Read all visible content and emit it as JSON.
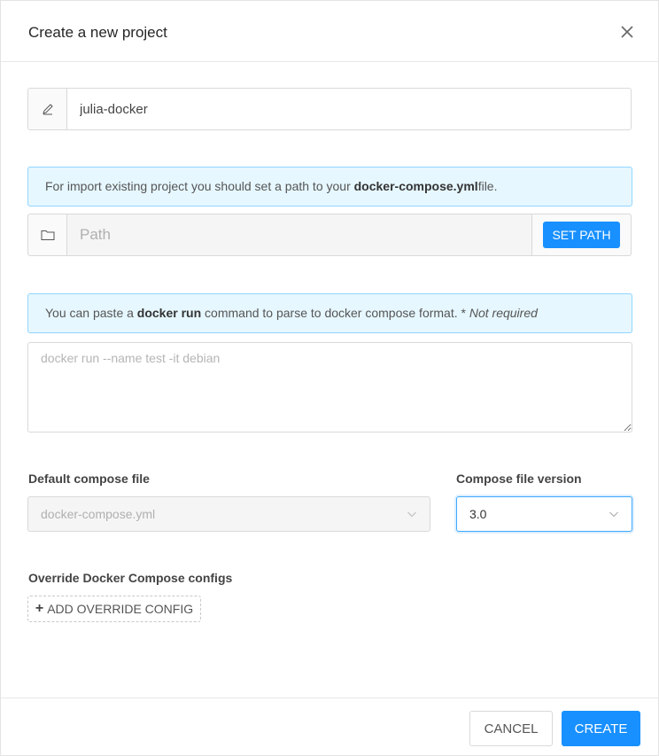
{
  "dialog": {
    "title": "Create a new project"
  },
  "project_name": {
    "value": "julia-docker",
    "icon": "pencil-icon"
  },
  "import_alert": {
    "prefix": "For import existing project you should set a path to your ",
    "bold": "docker-compose.yml",
    "suffix": "file."
  },
  "path": {
    "placeholder": "Path",
    "icon": "folder-icon",
    "button_label": "SET PATH"
  },
  "docker_run_alert": {
    "prefix": "You can paste a ",
    "bold": "docker run",
    "middle": " command to parse to docker compose format. * ",
    "italic": "Not required"
  },
  "docker_run": {
    "placeholder": "docker run --name test -it debian"
  },
  "default_compose": {
    "label": "Default compose file",
    "value": "docker-compose.yml"
  },
  "compose_version": {
    "label": "Compose file version",
    "value": "3.0"
  },
  "override": {
    "label": "Override Docker Compose configs",
    "button_label": "ADD OVERRIDE CONFIG"
  },
  "footer": {
    "cancel_label": "CANCEL",
    "create_label": "CREATE"
  },
  "colors": {
    "primary": "#1890ff",
    "alert_bg": "#e6f7ff",
    "alert_border": "#91d5ff"
  }
}
